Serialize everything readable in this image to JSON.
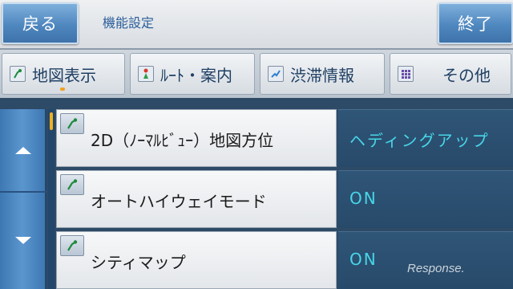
{
  "header": {
    "back_label": "戻る",
    "title": "機能設定",
    "end_label": "終了"
  },
  "tabs": [
    {
      "label": "地図表示",
      "icon": "map-pin-icon",
      "selected": true
    },
    {
      "label": "ﾙｰﾄ・案内",
      "icon": "route-flag-icon",
      "selected": false
    },
    {
      "label": "渋滞情報",
      "icon": "traffic-icon",
      "selected": false
    },
    {
      "label": "その他",
      "icon": "grid-icon",
      "selected": false
    }
  ],
  "settings": [
    {
      "label": "2D（ﾉｰﾏﾙﾋﾞｭｰ）地図方位",
      "value": "ヘディングアップ",
      "icon": "map-pin-icon"
    },
    {
      "label": "オートハイウェイモード",
      "value": "ON",
      "icon": "map-pin-icon"
    },
    {
      "label": "シティマップ",
      "value": "ON",
      "icon": "map-pin-icon"
    }
  ],
  "watermark": "Response.",
  "colors": {
    "button_blue": "#4f87bf",
    "value_text": "#47d6e8",
    "value_bg": "#2f5577",
    "accent_orange": "#f0a020"
  }
}
